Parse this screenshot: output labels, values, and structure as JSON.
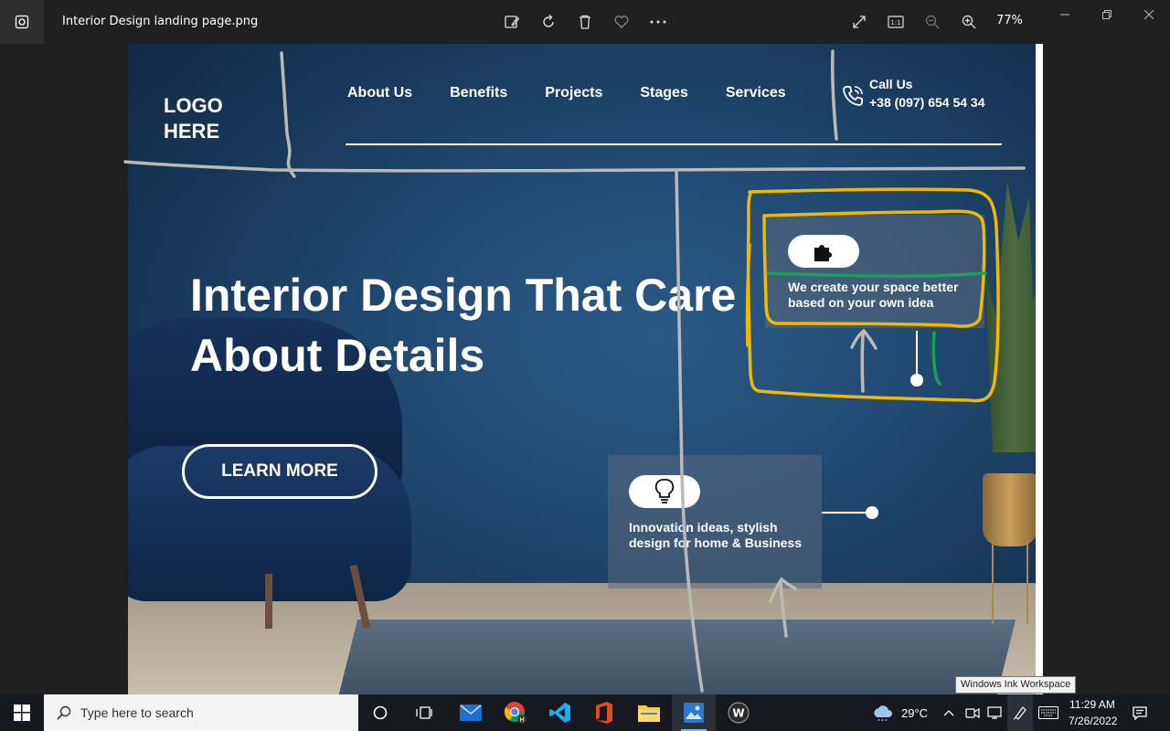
{
  "window": {
    "file_name": "Interior Design landing page.png",
    "zoom": "77%",
    "zoom_actual_size_label": "1:1"
  },
  "landing": {
    "logo": "LOGO\nHERE",
    "nav": [
      "About Us",
      "Benefits",
      "Projects",
      "Stages",
      "Services"
    ],
    "call_label": "Call Us",
    "call_number": "+38 (097) 654 54 34",
    "hero_title": "Interior Design That Care About Details",
    "cta": "LEARN MORE",
    "card1_text": "We create your space better based on your own idea",
    "card2_text": "Innovation ideas, stylish design for home & Business"
  },
  "tooltip": "Windows Ink Workspace",
  "taskbar": {
    "search_placeholder": "Type here to search",
    "temperature": "29°C",
    "time": "11:29 AM",
    "date": "7/26/2022",
    "apps": [
      "cortana-icon",
      "task-view-icon",
      "mail-icon",
      "chrome-icon",
      "vscode-icon",
      "office-icon",
      "file-explorer-icon",
      "photos-icon",
      "app-w-icon"
    ]
  },
  "colors": {
    "ink_gray": "#b9b9b9",
    "ink_yellow": "#f2b705",
    "ink_green": "#18a058",
    "taskbar_bg": "#16191f"
  }
}
